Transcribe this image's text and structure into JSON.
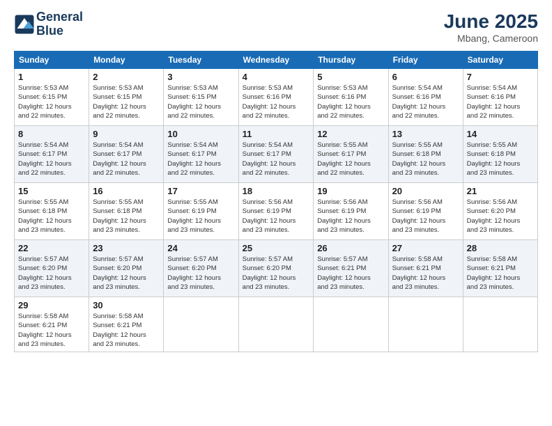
{
  "logo": {
    "line1": "General",
    "line2": "Blue"
  },
  "title": "June 2025",
  "location": "Mbang, Cameroon",
  "days_of_week": [
    "Sunday",
    "Monday",
    "Tuesday",
    "Wednesday",
    "Thursday",
    "Friday",
    "Saturday"
  ],
  "weeks": [
    [
      {
        "day": "1",
        "sunrise": "5:53 AM",
        "sunset": "6:15 PM",
        "daylight": "12 hours and 22 minutes."
      },
      {
        "day": "2",
        "sunrise": "5:53 AM",
        "sunset": "6:15 PM",
        "daylight": "12 hours and 22 minutes."
      },
      {
        "day": "3",
        "sunrise": "5:53 AM",
        "sunset": "6:15 PM",
        "daylight": "12 hours and 22 minutes."
      },
      {
        "day": "4",
        "sunrise": "5:53 AM",
        "sunset": "6:16 PM",
        "daylight": "12 hours and 22 minutes."
      },
      {
        "day": "5",
        "sunrise": "5:53 AM",
        "sunset": "6:16 PM",
        "daylight": "12 hours and 22 minutes."
      },
      {
        "day": "6",
        "sunrise": "5:54 AM",
        "sunset": "6:16 PM",
        "daylight": "12 hours and 22 minutes."
      },
      {
        "day": "7",
        "sunrise": "5:54 AM",
        "sunset": "6:16 PM",
        "daylight": "12 hours and 22 minutes."
      }
    ],
    [
      {
        "day": "8",
        "sunrise": "5:54 AM",
        "sunset": "6:17 PM",
        "daylight": "12 hours and 22 minutes."
      },
      {
        "day": "9",
        "sunrise": "5:54 AM",
        "sunset": "6:17 PM",
        "daylight": "12 hours and 22 minutes."
      },
      {
        "day": "10",
        "sunrise": "5:54 AM",
        "sunset": "6:17 PM",
        "daylight": "12 hours and 22 minutes."
      },
      {
        "day": "11",
        "sunrise": "5:54 AM",
        "sunset": "6:17 PM",
        "daylight": "12 hours and 22 minutes."
      },
      {
        "day": "12",
        "sunrise": "5:55 AM",
        "sunset": "6:17 PM",
        "daylight": "12 hours and 22 minutes."
      },
      {
        "day": "13",
        "sunrise": "5:55 AM",
        "sunset": "6:18 PM",
        "daylight": "12 hours and 23 minutes."
      },
      {
        "day": "14",
        "sunrise": "5:55 AM",
        "sunset": "6:18 PM",
        "daylight": "12 hours and 23 minutes."
      }
    ],
    [
      {
        "day": "15",
        "sunrise": "5:55 AM",
        "sunset": "6:18 PM",
        "daylight": "12 hours and 23 minutes."
      },
      {
        "day": "16",
        "sunrise": "5:55 AM",
        "sunset": "6:18 PM",
        "daylight": "12 hours and 23 minutes."
      },
      {
        "day": "17",
        "sunrise": "5:55 AM",
        "sunset": "6:19 PM",
        "daylight": "12 hours and 23 minutes."
      },
      {
        "day": "18",
        "sunrise": "5:56 AM",
        "sunset": "6:19 PM",
        "daylight": "12 hours and 23 minutes."
      },
      {
        "day": "19",
        "sunrise": "5:56 AM",
        "sunset": "6:19 PM",
        "daylight": "12 hours and 23 minutes."
      },
      {
        "day": "20",
        "sunrise": "5:56 AM",
        "sunset": "6:19 PM",
        "daylight": "12 hours and 23 minutes."
      },
      {
        "day": "21",
        "sunrise": "5:56 AM",
        "sunset": "6:20 PM",
        "daylight": "12 hours and 23 minutes."
      }
    ],
    [
      {
        "day": "22",
        "sunrise": "5:57 AM",
        "sunset": "6:20 PM",
        "daylight": "12 hours and 23 minutes."
      },
      {
        "day": "23",
        "sunrise": "5:57 AM",
        "sunset": "6:20 PM",
        "daylight": "12 hours and 23 minutes."
      },
      {
        "day": "24",
        "sunrise": "5:57 AM",
        "sunset": "6:20 PM",
        "daylight": "12 hours and 23 minutes."
      },
      {
        "day": "25",
        "sunrise": "5:57 AM",
        "sunset": "6:20 PM",
        "daylight": "12 hours and 23 minutes."
      },
      {
        "day": "26",
        "sunrise": "5:57 AM",
        "sunset": "6:21 PM",
        "daylight": "12 hours and 23 minutes."
      },
      {
        "day": "27",
        "sunrise": "5:58 AM",
        "sunset": "6:21 PM",
        "daylight": "12 hours and 23 minutes."
      },
      {
        "day": "28",
        "sunrise": "5:58 AM",
        "sunset": "6:21 PM",
        "daylight": "12 hours and 23 minutes."
      }
    ],
    [
      {
        "day": "29",
        "sunrise": "5:58 AM",
        "sunset": "6:21 PM",
        "daylight": "12 hours and 23 minutes."
      },
      {
        "day": "30",
        "sunrise": "5:58 AM",
        "sunset": "6:21 PM",
        "daylight": "12 hours and 23 minutes."
      },
      null,
      null,
      null,
      null,
      null
    ]
  ]
}
